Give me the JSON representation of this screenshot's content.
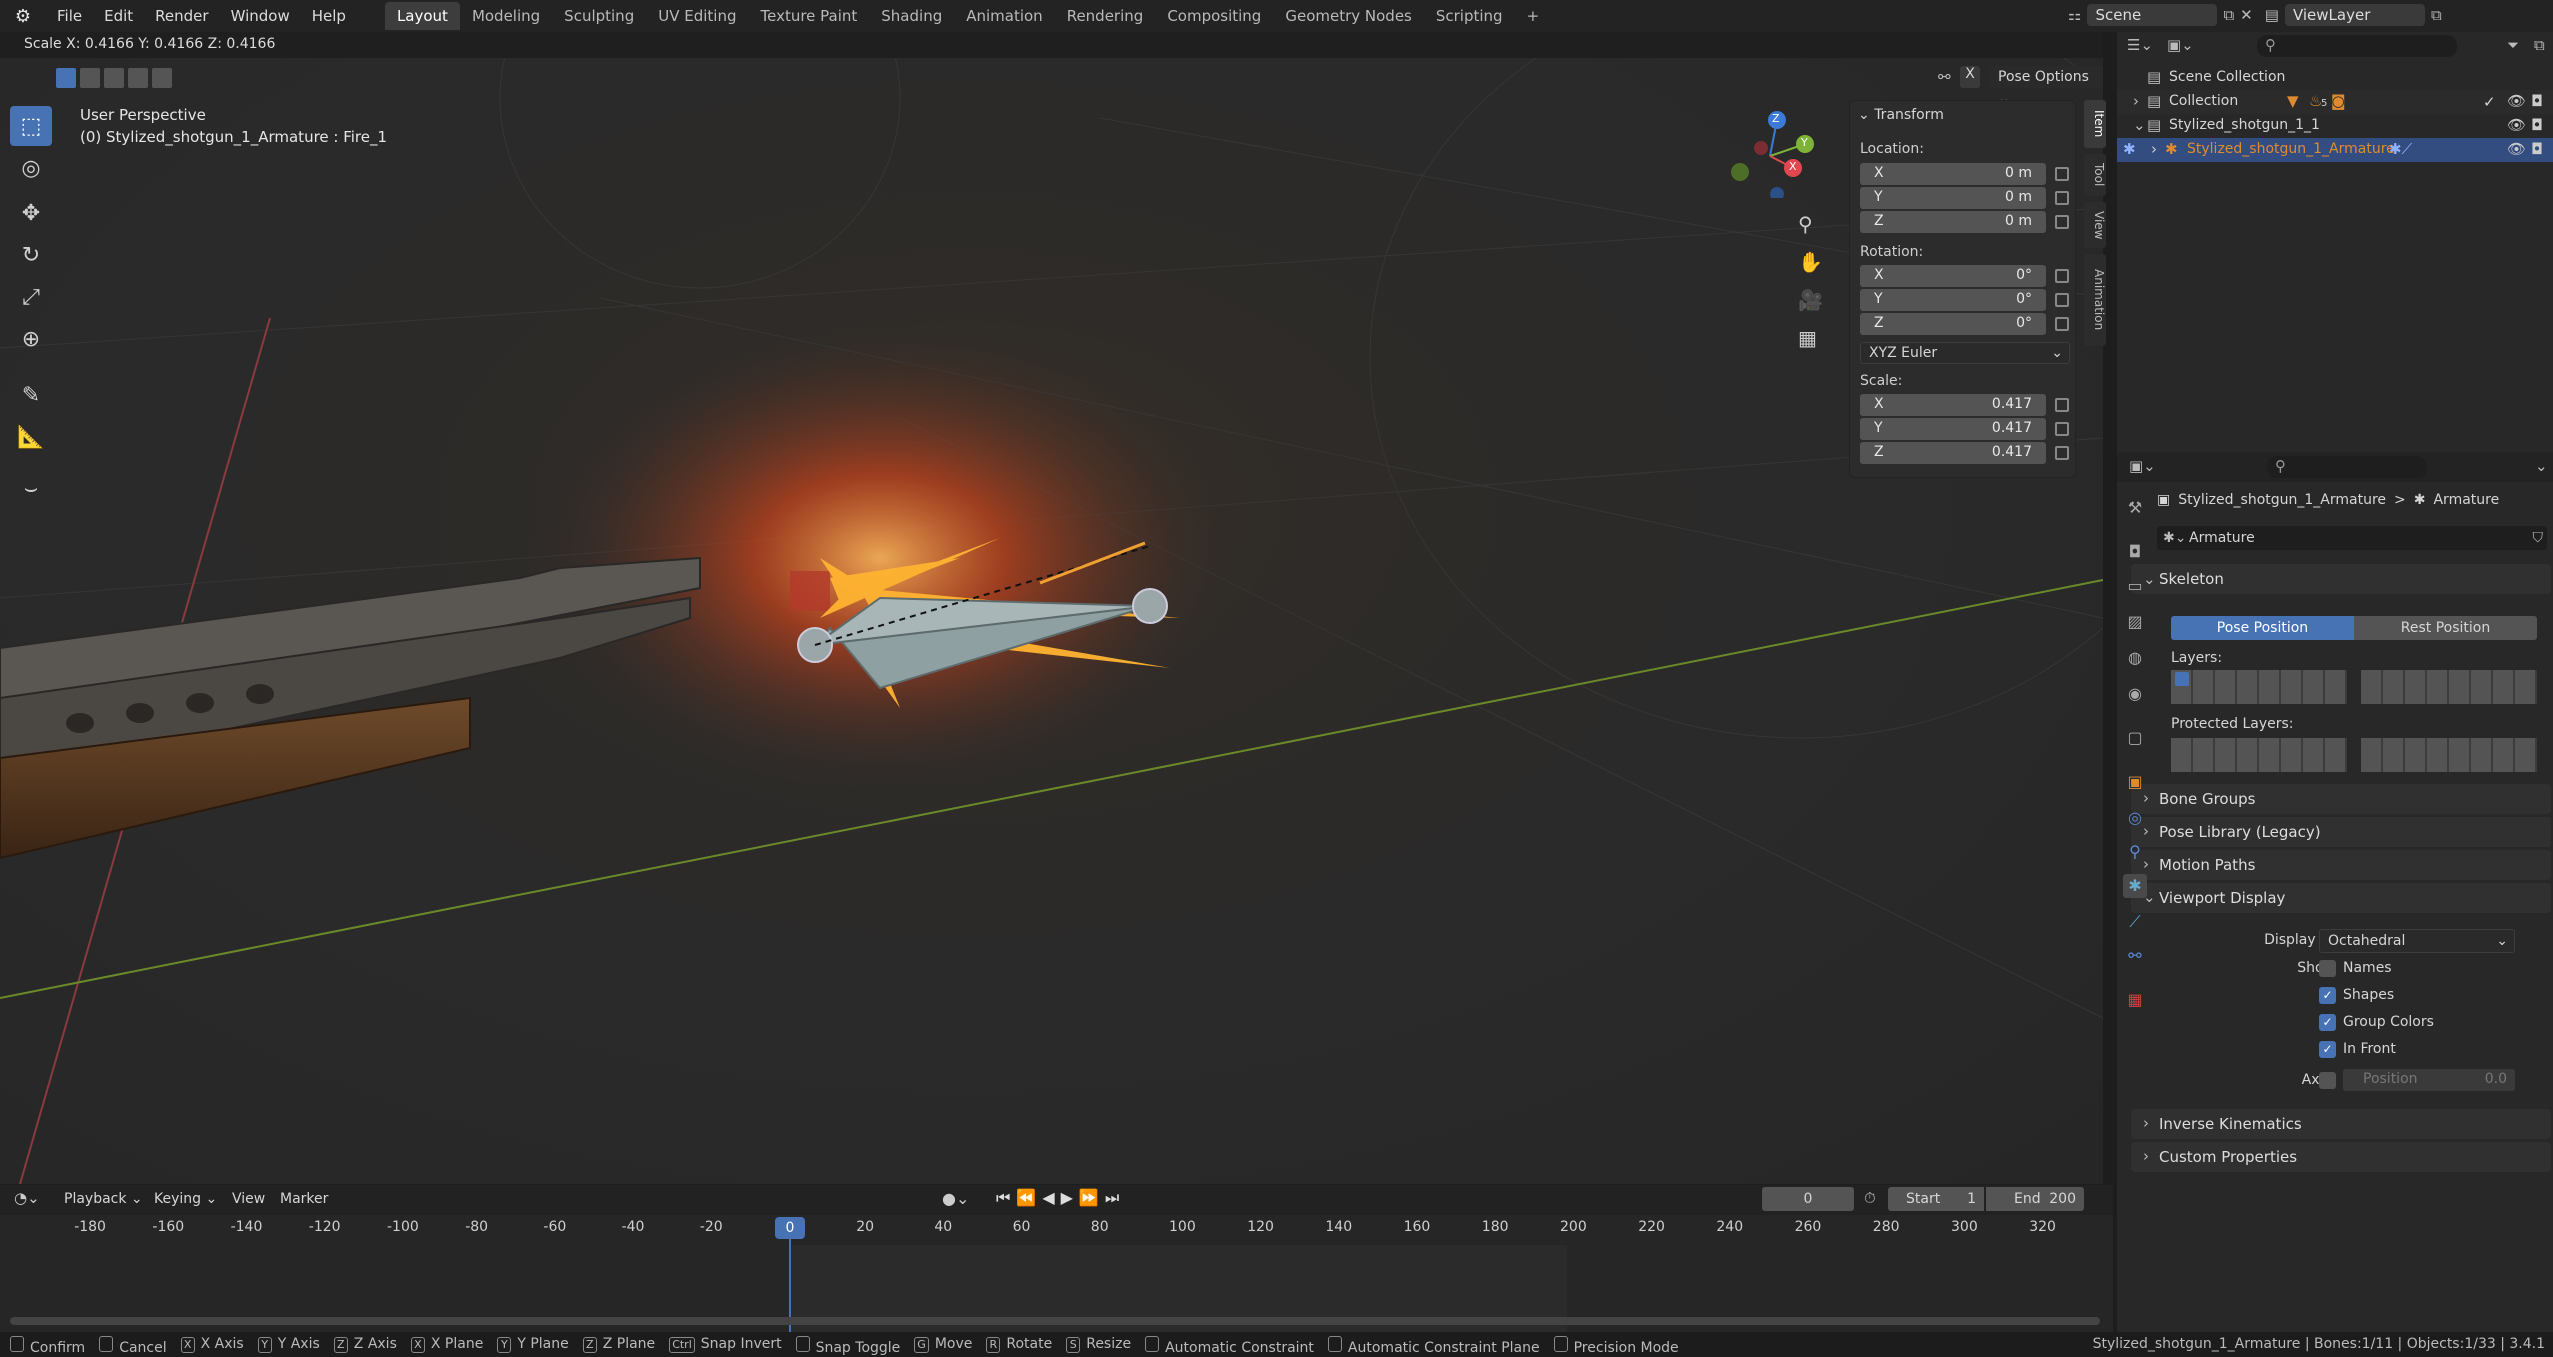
{
  "menu": [
    "File",
    "Edit",
    "Render",
    "Window",
    "Help"
  ],
  "workspaces": [
    "Layout",
    "Modeling",
    "Sculpting",
    "UV Editing",
    "Texture Paint",
    "Shading",
    "Animation",
    "Rendering",
    "Compositing",
    "Geometry Nodes",
    "Scripting",
    "+"
  ],
  "scene_name": "Scene",
  "view_layer": "ViewLayer",
  "header_status": "Scale X: 0.4166   Y: 0.4166   Z: 0.4166",
  "viewport": {
    "perspective": "User Perspective",
    "object_info": "(0) Stylized_shotgun_1_Armature : Fire_1",
    "pose_options": "Pose Options",
    "x_label": "X"
  },
  "gizmo": {
    "x": "X",
    "y": "Y",
    "z": "Z"
  },
  "npanel": {
    "title": "Transform",
    "location_label": "Location:",
    "location": [
      {
        "axis": "X",
        "value": "0 m"
      },
      {
        "axis": "Y",
        "value": "0 m"
      },
      {
        "axis": "Z",
        "value": "0 m"
      }
    ],
    "rotation_label": "Rotation:",
    "rotation": [
      {
        "axis": "X",
        "value": "0°"
      },
      {
        "axis": "Y",
        "value": "0°"
      },
      {
        "axis": "Z",
        "value": "0°"
      }
    ],
    "rotation_mode": "XYZ Euler",
    "scale_label": "Scale:",
    "scale": [
      {
        "axis": "X",
        "value": "0.417"
      },
      {
        "axis": "Y",
        "value": "0.417"
      },
      {
        "axis": "Z",
        "value": "0.417"
      }
    ]
  },
  "side_tabs": [
    "Item",
    "Tool",
    "View",
    "Animation"
  ],
  "outliner": {
    "root": "Scene Collection",
    "items": [
      {
        "label": "Collection"
      },
      {
        "label": "Stylized_shotgun_1_1"
      },
      {
        "label": "Stylized_shotgun_1_Armature"
      }
    ],
    "count_badge": "5"
  },
  "properties": {
    "breadcrumb_obj": "Stylized_shotgun_1_Armature",
    "breadcrumb_sep": ">",
    "breadcrumb_data": "Armature",
    "datablock": "Armature",
    "skeleton": "Skeleton",
    "pose_position": "Pose Position",
    "rest_position": "Rest Position",
    "layers": "Layers:",
    "protected_layers": "Protected Layers:",
    "bone_groups": "Bone Groups",
    "pose_library": "Pose Library (Legacy)",
    "motion_paths": "Motion Paths",
    "viewport_display": "Viewport Display",
    "display_as_label": "Display As",
    "display_as_value": "Octahedral",
    "show_label": "Show",
    "names": "Names",
    "shapes": "Shapes",
    "group_colors": "Group Colors",
    "in_front": "In Front",
    "axes_label": "Axes",
    "position_label": "Position",
    "position_value": "0.0",
    "ik": "Inverse Kinematics",
    "custom_props": "Custom Properties"
  },
  "timeline": {
    "menus": [
      "Playback",
      "Keying",
      "View",
      "Marker"
    ],
    "current_frame": "0",
    "start_label": "Start",
    "start": "1",
    "end_label": "End",
    "end": "200",
    "ticks": [
      "-180",
      "-160",
      "-140",
      "-120",
      "-100",
      "-80",
      "-60",
      "-40",
      "-20",
      "0",
      "20",
      "40",
      "60",
      "80",
      "100",
      "120",
      "140",
      "160",
      "180",
      "200",
      "220",
      "240",
      "260",
      "280",
      "300",
      "320"
    ],
    "playhead": "0"
  },
  "statusbar": {
    "items": [
      "Confirm",
      "Cancel",
      "X Axis",
      "Y Axis",
      "Z Axis",
      "X Plane",
      "Y Plane",
      "Z Plane",
      "Snap Invert",
      "Snap Toggle",
      "Move",
      "Rotate",
      "Resize",
      "Automatic Constraint",
      "Automatic Constraint Plane",
      "Precision Mode"
    ],
    "keys": [
      "",
      "",
      "X",
      "Y",
      "Z",
      "X",
      "Y",
      "Z",
      "Ctrl",
      "",
      "G",
      "R",
      "S",
      "",
      "",
      ""
    ],
    "right": "Stylized_shotgun_1_Armature | Bones:1/11 | Objects:1/33 | 3.4.1"
  },
  "colors": {
    "accent": "#4772b3",
    "selected_row": "#334d80",
    "x_axis": "#e0474e",
    "y_axis": "#7db437",
    "z_axis": "#3d7ad6"
  }
}
